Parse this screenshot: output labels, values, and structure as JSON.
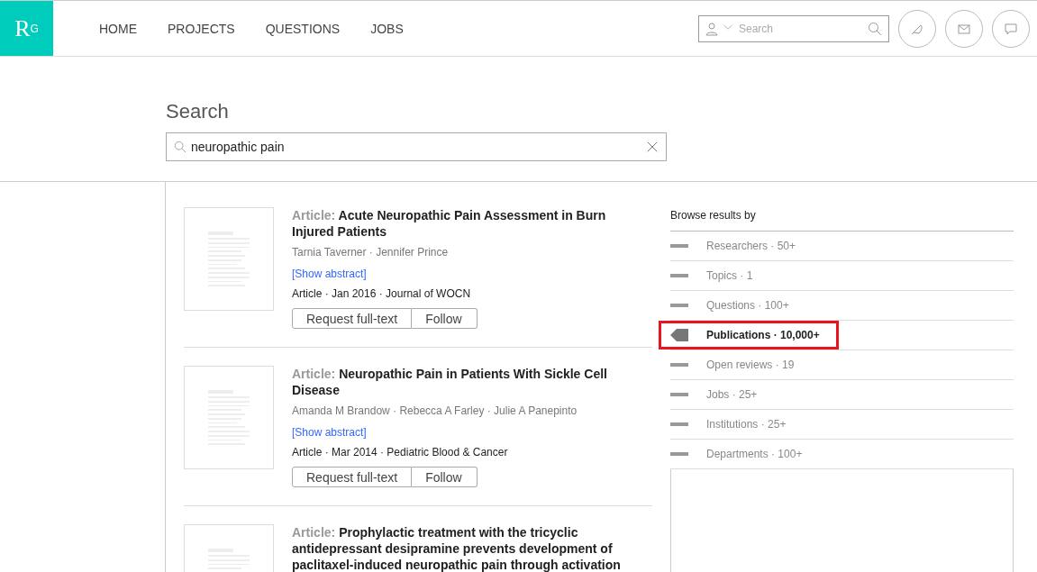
{
  "header": {
    "logo": {
      "letter": "R",
      "superscript": "G"
    },
    "nav": [
      {
        "label": "HOME"
      },
      {
        "label": "PROJECTS"
      },
      {
        "label": "QUESTIONS"
      },
      {
        "label": "JOBS"
      }
    ],
    "search": {
      "placeholder": "Search"
    }
  },
  "search_section": {
    "title": "Search",
    "query": "neuropathic pain"
  },
  "results": [
    {
      "type_label": "Article:",
      "title": "Acute Neuropathic Pain Assessment in Burn Injured Patients",
      "authors": "Tarnia Taverner · Jennifer Prince",
      "abstract_link": "[Show abstract]",
      "meta": "Article · Jan 2016 · Journal of WOCN",
      "buttons": [
        "Request full-text",
        "Follow"
      ]
    },
    {
      "type_label": "Article:",
      "title": "Neuropathic Pain in Patients With Sickle Cell Disease",
      "authors": "Amanda M Brandow · Rebecca A Farley · Julie A Panepinto",
      "abstract_link": "[Show abstract]",
      "meta": "Article · Mar 2014 · Pediatric Blood & Cancer",
      "buttons": [
        "Request full-text",
        "Follow"
      ]
    },
    {
      "type_label": "Article:",
      "title": "Prophylactic treatment with the tricyclic antidepressant desipramine prevents development of paclitaxel-induced neuropathic pain through activation"
    }
  ],
  "browse": {
    "title": "Browse results by",
    "items": [
      {
        "label": "Researchers · 50+",
        "selected": false,
        "highlighted": false
      },
      {
        "label": "Topics · 1",
        "selected": false,
        "highlighted": false
      },
      {
        "label": "Questions · 100+",
        "selected": false,
        "highlighted": false
      },
      {
        "label": "Publications · 10,000+",
        "selected": true,
        "highlighted": true
      },
      {
        "label": "Open reviews · 19",
        "selected": false,
        "highlighted": false
      },
      {
        "label": "Jobs · 25+",
        "selected": false,
        "highlighted": false
      },
      {
        "label": "Institutions · 25+",
        "selected": false,
        "highlighted": false
      },
      {
        "label": "Departments · 100+",
        "selected": false,
        "highlighted": false
      }
    ]
  }
}
